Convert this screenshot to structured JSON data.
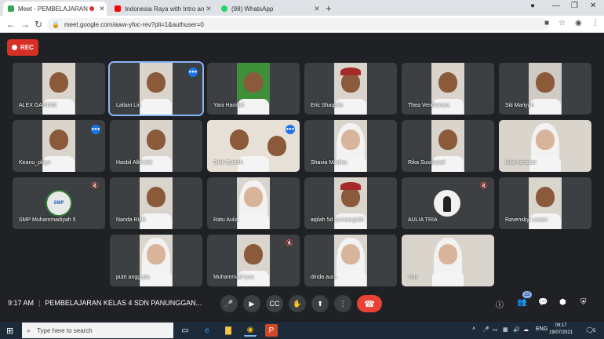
{
  "browser": {
    "tabs": [
      {
        "title": "Meet - PEMBELAJARAN KEL...",
        "active": true,
        "favicon_color": "#34a853"
      },
      {
        "title": "Indonesia Raya with Intro and Te...",
        "active": false,
        "favicon_color": "#ff0000"
      },
      {
        "title": "(98) WhatsApp",
        "active": false,
        "favicon_color": "#25d366"
      }
    ],
    "new_tab": "+",
    "url": "meet.google.com/aww-yfoc-rev?pli=1&authuser=0"
  },
  "meet": {
    "rec_label": "REC",
    "participants": [
      {
        "name": "ALEX GAMING",
        "kind": "boy"
      },
      {
        "name": "Lailani Lin",
        "kind": "boy",
        "speaking": true,
        "talk": true
      },
      {
        "name": "Yani Hanifah",
        "kind": "green"
      },
      {
        "name": "Eric Shaquila",
        "kind": "hat"
      },
      {
        "name": "Thea Vendianata",
        "kind": "boy"
      },
      {
        "name": "Siti Mariyah",
        "kind": "hand"
      },
      {
        "name": "Keanu_plays",
        "kind": "boy",
        "talk": true
      },
      {
        "name": "Hasbil Alkholid",
        "kind": "boy"
      },
      {
        "name": "Ocih Gardih",
        "kind": "pair",
        "talk": true
      },
      {
        "name": "Shavia Madina",
        "kind": "hijab"
      },
      {
        "name": "Rika Susilawati",
        "kind": "boy"
      },
      {
        "name": "laila hanatan",
        "kind": "hijabwide"
      },
      {
        "name": "SMP Muhammadiyah 5",
        "kind": "logo",
        "muted": true
      },
      {
        "name": "Nanda Rizki",
        "kind": "boy"
      },
      {
        "name": "Ratu Aulia",
        "kind": "hijab"
      },
      {
        "name": "aqilah 5d purwangisih",
        "kind": "hat"
      },
      {
        "name": "AULIA TRIA",
        "kind": "avatar",
        "muted": true
      },
      {
        "name": "Ravensky Lestari",
        "kind": "boy"
      },
      {
        "name": "putri anggada",
        "kind": "hijab"
      },
      {
        "name": "Muhammad Iyus",
        "kind": "boy",
        "muted": true
      },
      {
        "name": "dinda aura",
        "kind": "hijab"
      },
      {
        "name": "You",
        "kind": "hijabwide"
      }
    ],
    "logo_text": "SMP",
    "mic_icon": "🔇",
    "talk_icon": "●●●"
  },
  "bottom_bar": {
    "time": "9:17 AM",
    "meeting_title": "PEMBELAJARAN KELAS 4 SDN PANUNGGAN...",
    "people_count": "22"
  },
  "taskbar": {
    "search_placeholder": "Type here to search",
    "lang": "ENG",
    "time": "09:17",
    "date": "19/07/2021",
    "notifications": "5"
  }
}
